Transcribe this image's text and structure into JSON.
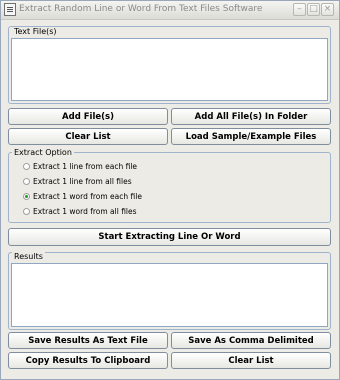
{
  "window": {
    "title": "Extract Random Line or Word From Text Files Software"
  },
  "titlebar_buttons": {
    "minimize": "–",
    "maximize": "□",
    "close": "×"
  },
  "files_group": {
    "label": "Text File(s)"
  },
  "buttons": {
    "add_files": "Add File(s)",
    "add_all_folder": "Add All File(s) In Folder",
    "clear_list": "Clear List",
    "load_sample": "Load Sample/Example Files",
    "start": "Start Extracting Line Or Word",
    "save_text": "Save Results As Text File",
    "save_comma": "Save As Comma Delimited",
    "copy_clipboard": "Copy Results To Clipboard",
    "clear_results": "Clear List"
  },
  "extract_option": {
    "label": "Extract Option",
    "options": [
      {
        "label": "Extract 1 line from each file",
        "checked": false
      },
      {
        "label": "Extract 1 line from all files",
        "checked": false
      },
      {
        "label": "Extract 1 word from each file",
        "checked": true
      },
      {
        "label": "Extract 1 word from all files",
        "checked": false
      }
    ]
  },
  "results_group": {
    "label": "Results"
  }
}
